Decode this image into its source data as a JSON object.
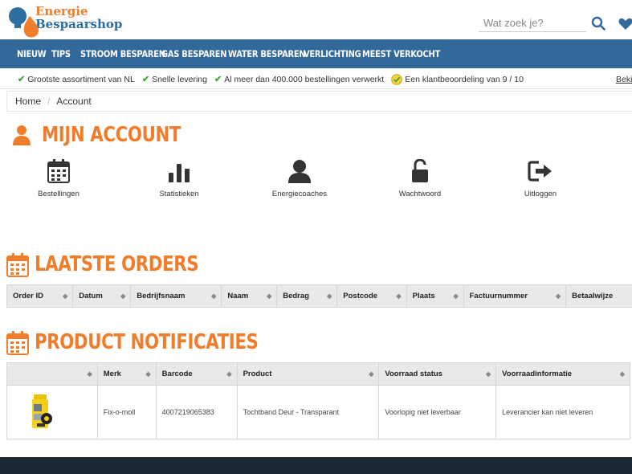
{
  "brand": {
    "line1": "Energie",
    "line2": "Bespaarshop"
  },
  "search": {
    "placeholder": "Wat zoek je?"
  },
  "nav": [
    "NIEUW",
    "TIPS",
    "STROOM BESPAREN",
    "GAS BESPAREN",
    "WATER BESPAREN",
    "VERLICHTING",
    "MEEST VERKOCHT"
  ],
  "usp": {
    "items": [
      "Grootste assortiment van NL",
      "Snelle levering",
      "Al meer dan 400.000 bestellingen verwerkt",
      "Een klantbeoordeling van 9 / 10"
    ],
    "right": "Beki"
  },
  "breadcrumb": {
    "home": "Home",
    "current": "Account"
  },
  "account": {
    "title": "MIJN ACCOUNT",
    "tiles": [
      "Bestellingen",
      "Statistieken",
      "Energiecoaches",
      "Wachtwoord",
      "Uitloggen"
    ]
  },
  "orders": {
    "title": "LAATSTE ORDERS",
    "columns": [
      "Order ID",
      "Datum",
      "Bedrijfsnaam",
      "Naam",
      "Bedrag",
      "Postcode",
      "Plaats",
      "Factuurnummer",
      "Betaalwijze"
    ]
  },
  "notifications": {
    "title": "PRODUCT NOTIFICATIES",
    "columns": [
      "",
      "Merk",
      "Barcode",
      "Product",
      "Voorraad status",
      "Voorraadinformatie"
    ],
    "rows": [
      {
        "merk": "Fix-o-moll",
        "barcode": "4007219065383",
        "product": "Tochtband Deur - Transparant",
        "status": "Voorlopig niet leverbaar",
        "info": "Leverancier kan niet leveren"
      }
    ]
  },
  "colors": {
    "accent": "#ef7d2c",
    "nav": "#31699b",
    "check": "#3fa535",
    "footer": "#1b2633"
  }
}
